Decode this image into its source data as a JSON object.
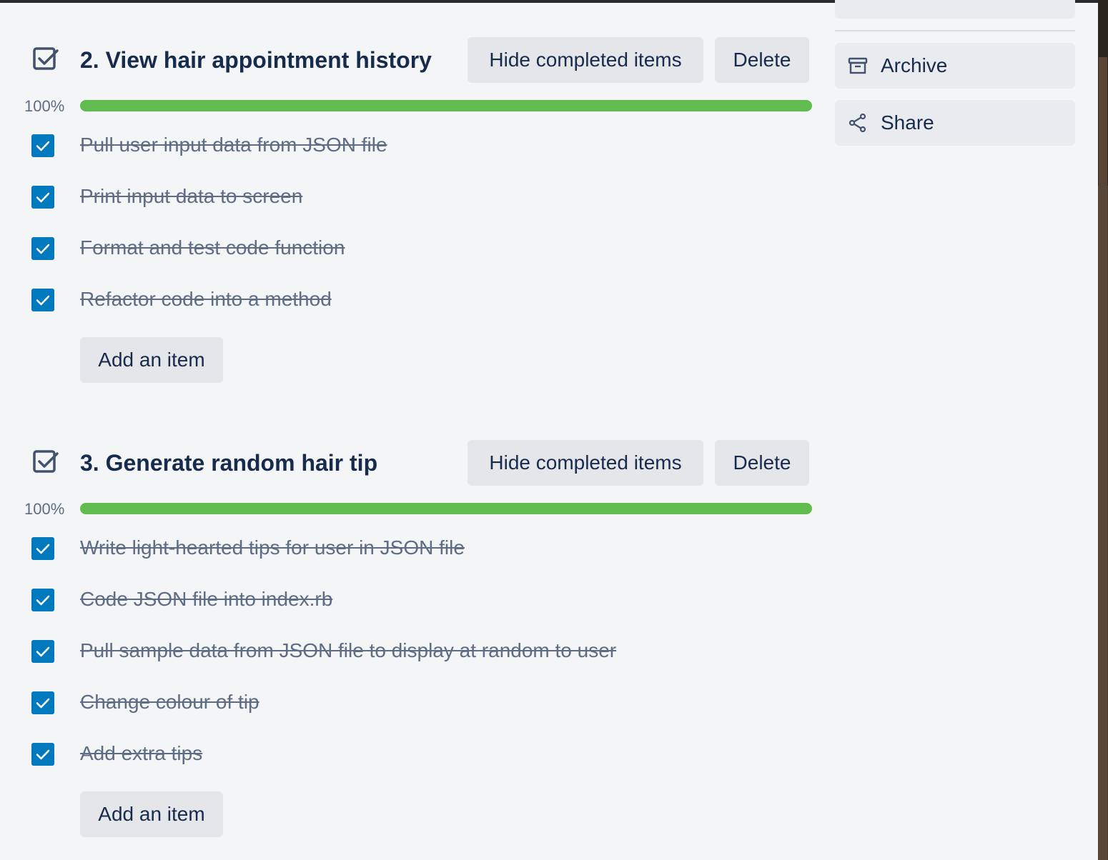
{
  "checklists": [
    {
      "title": "2. View hair appointment history",
      "hide_label": "Hide completed items",
      "delete_label": "Delete",
      "percent_label": "100%",
      "progress": 1.0,
      "items": [
        {
          "text": "Pull user input data from JSON file",
          "checked": true
        },
        {
          "text": "Print input data to screen",
          "checked": true
        },
        {
          "text": "Format and test code function",
          "checked": true
        },
        {
          "text": "Refactor code into a method",
          "checked": true
        }
      ],
      "add_label": "Add an item"
    },
    {
      "title": "3. Generate random hair tip",
      "hide_label": "Hide completed items",
      "delete_label": "Delete",
      "percent_label": "100%",
      "progress": 1.0,
      "items": [
        {
          "text": "Write light-hearted tips for user in JSON file",
          "checked": true
        },
        {
          "text": "Code JSON file into index.rb",
          "checked": true
        },
        {
          "text": "Pull sample data from JSON file to display at random to user",
          "checked": true
        },
        {
          "text": "Change colour of tip",
          "checked": true
        },
        {
          "text": "Add extra tips",
          "checked": true
        }
      ],
      "add_label": "Add an item"
    }
  ],
  "sidebar": {
    "archive_label": "Archive",
    "share_label": "Share"
  },
  "colors": {
    "progress": "#61bd4f",
    "checkbox": "#0079bf",
    "button_bg": "#e4e6ea"
  },
  "icons": {
    "checklist": "checklist-icon",
    "archive": "archive-icon",
    "share": "share-icon",
    "check": "checkmark-icon"
  }
}
